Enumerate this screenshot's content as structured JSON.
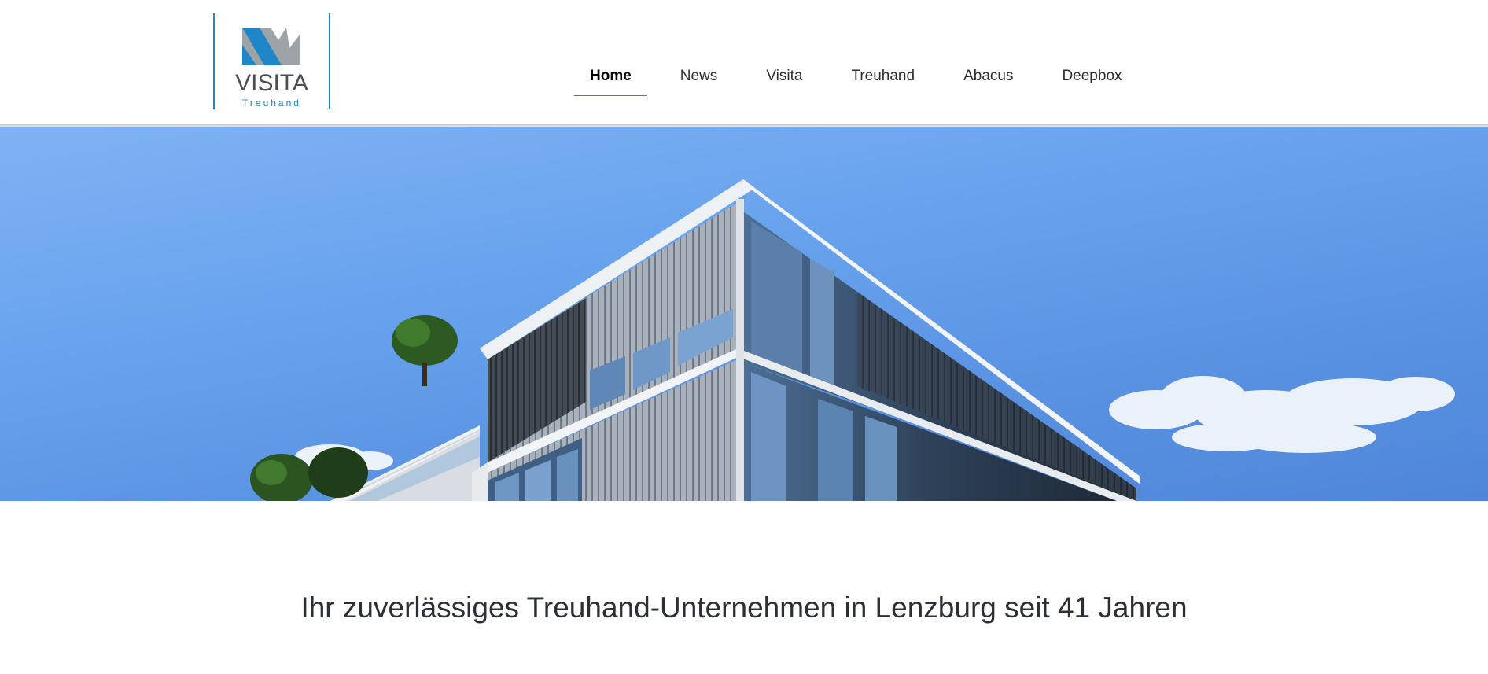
{
  "header": {
    "logo": {
      "wordmark": "VISITA",
      "subtitle": "Treuhand"
    },
    "nav": [
      {
        "label": "Home",
        "active": true
      },
      {
        "label": "News",
        "active": false
      },
      {
        "label": "Visita",
        "active": false
      },
      {
        "label": "Treuhand",
        "active": false
      },
      {
        "label": "Abacus",
        "active": false
      },
      {
        "label": "Deepbox",
        "active": false
      }
    ]
  },
  "hero": {
    "image": "modern-office-building-photo"
  },
  "main": {
    "heading": "Ihr zuverlässiges Treuhand-Unternehmen in Lenzburg seit 41 Jahren"
  },
  "colors": {
    "accent": "#1f86c8",
    "text": "#2b2f33",
    "sky": "#6aa4ee"
  }
}
